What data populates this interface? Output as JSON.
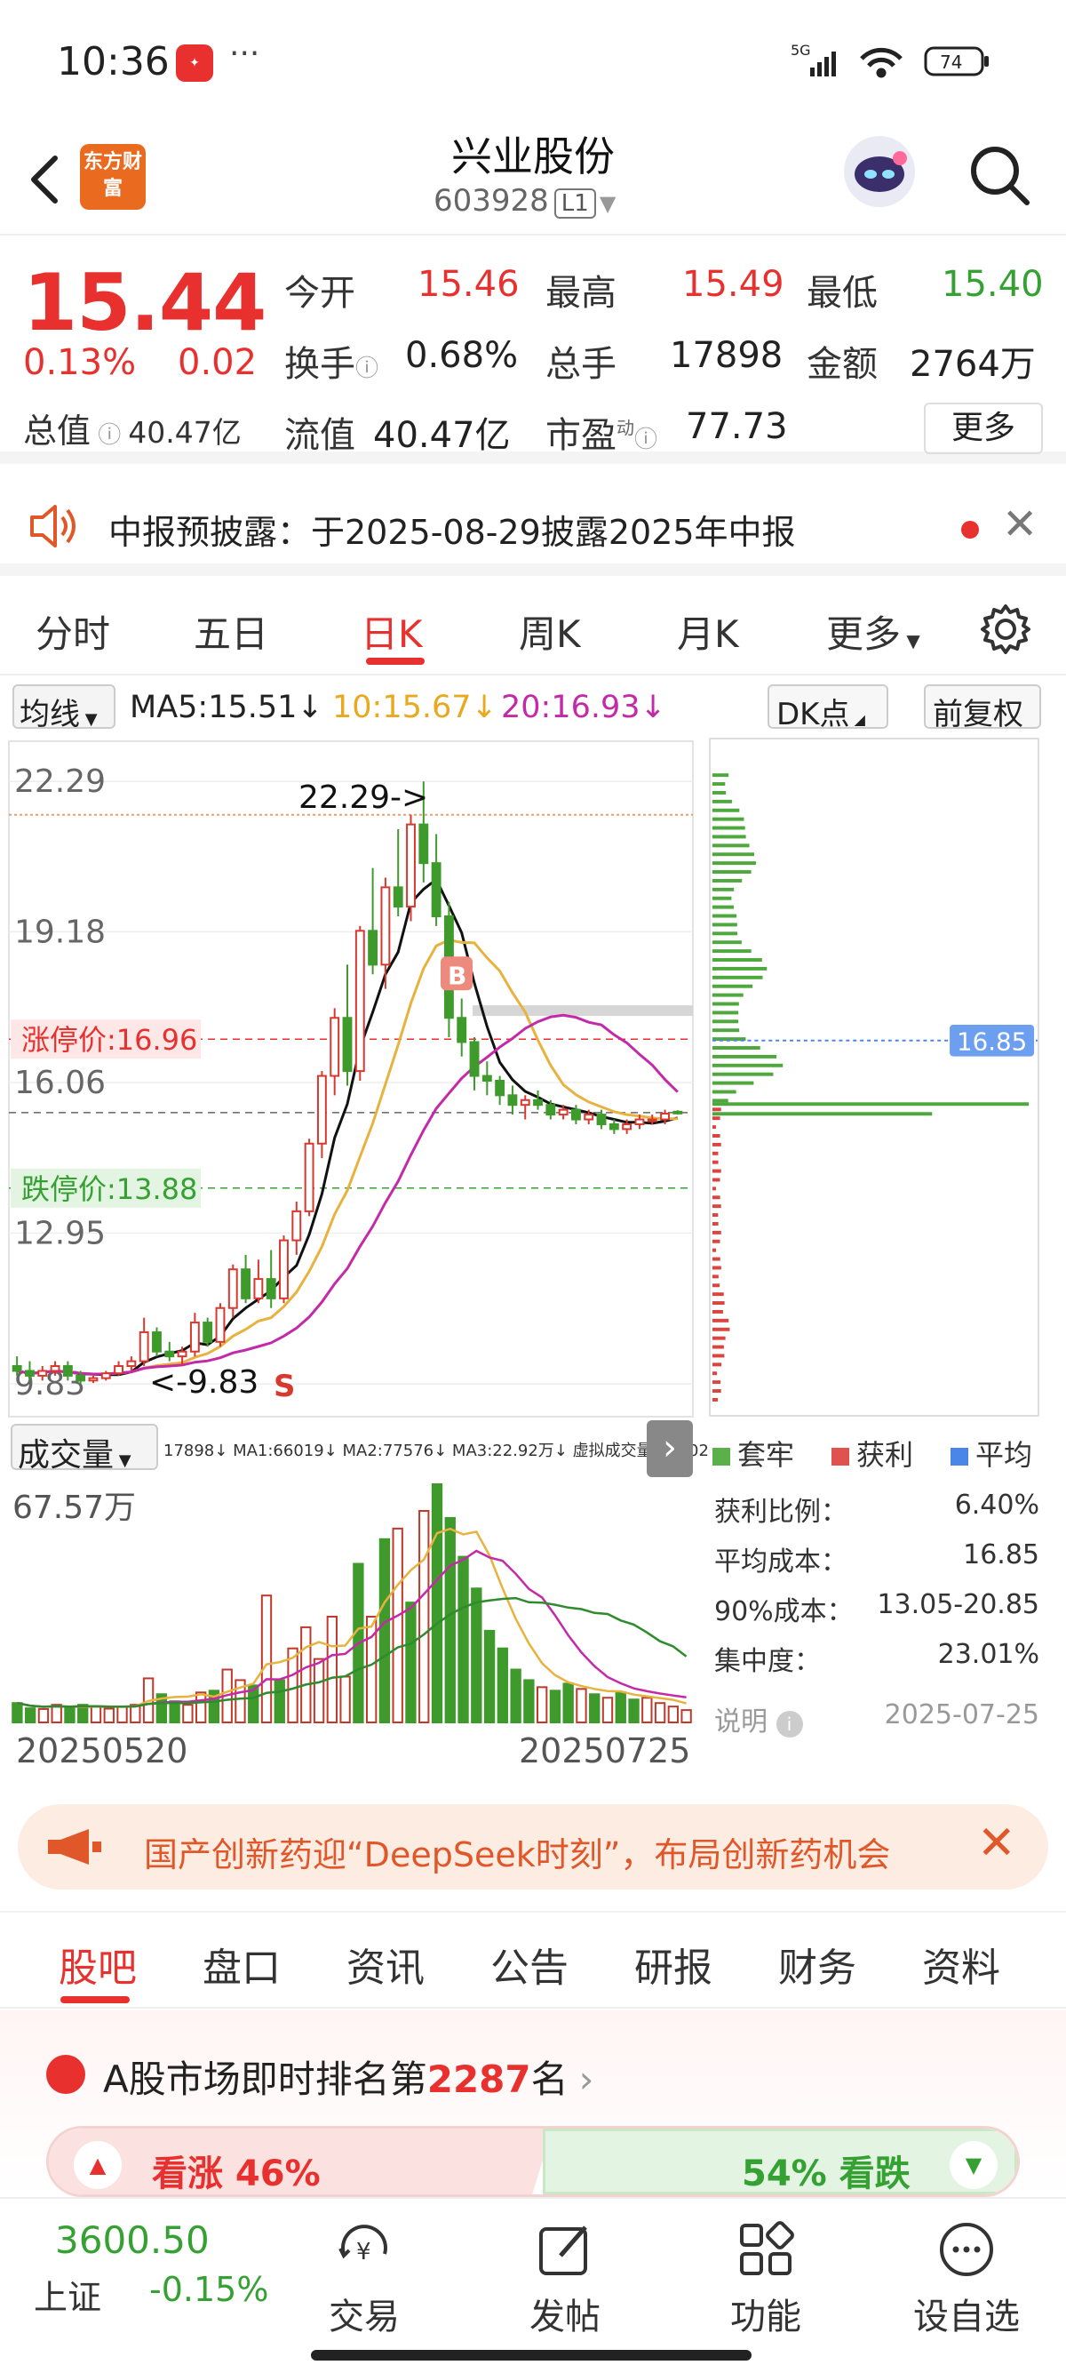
{
  "status_bar": {
    "time": "10:36",
    "dots": "···",
    "battery": "74",
    "network": "5G"
  },
  "nav": {
    "title": "兴业股份",
    "code": "603928",
    "level": "L1",
    "logo": "东方财富"
  },
  "quote": {
    "price": "15.44",
    "change_pct": "0.13%",
    "change_abs": "0.02",
    "total_value_label": "总值",
    "total_value": "40.47亿",
    "fields": [
      {
        "label": "今开",
        "value": "15.46",
        "color": "red"
      },
      {
        "label": "最高",
        "value": "15.49",
        "color": "red"
      },
      {
        "label": "最低",
        "value": "15.40",
        "color": "green"
      },
      {
        "label": "换手",
        "value": "0.68%",
        "color": "black"
      },
      {
        "label": "总手",
        "value": "17898",
        "color": "black"
      },
      {
        "label": "金额",
        "value": "2764万",
        "color": "black"
      },
      {
        "label": "流值",
        "value": "40.47亿",
        "color": "black"
      },
      {
        "label": "市盈",
        "value": "77.73",
        "color": "black"
      }
    ],
    "pe_sup": "动",
    "more_label": "更多"
  },
  "notice": {
    "text": "中报预披露：于2025-08-29披露2025年中报"
  },
  "tabs": [
    "分时",
    "五日",
    "日K",
    "周K",
    "月K",
    "更多"
  ],
  "ma": {
    "selector": "均线",
    "ma5": "MA5:15.51",
    "ma10": "10:15.67",
    "ma20": "20:16.93",
    "arrow": "↓",
    "dk": "DK点",
    "adjust": "前复权"
  },
  "chart_data": {
    "type": "candlestick",
    "y_labels": [
      "22.29",
      "19.18",
      "16.06",
      "12.95",
      "9.83"
    ],
    "y_range": [
      9.83,
      22.29
    ],
    "limit_up": "涨停价:16.96",
    "limit_down": "跌停价:13.88",
    "high_marker": "22.29->",
    "low_marker": "<-9.83",
    "chip_marker": "16.85",
    "signals": [
      "B",
      "S"
    ],
    "candles": [
      [
        10.2,
        10.4,
        10.0,
        10.1
      ],
      [
        10.1,
        10.3,
        9.9,
        10.0
      ],
      [
        10.0,
        10.2,
        9.9,
        10.1
      ],
      [
        10.1,
        10.3,
        10.0,
        10.2
      ],
      [
        10.2,
        10.3,
        9.9,
        10.0
      ],
      [
        10.0,
        10.1,
        9.83,
        9.9
      ],
      [
        9.9,
        10.0,
        9.85,
        9.95
      ],
      [
        9.95,
        10.1,
        9.9,
        10.05
      ],
      [
        10.05,
        10.3,
        10.0,
        10.2
      ],
      [
        10.2,
        10.4,
        10.1,
        10.3
      ],
      [
        10.3,
        11.2,
        10.2,
        10.9
      ],
      [
        10.9,
        11.0,
        10.4,
        10.5
      ],
      [
        10.5,
        10.7,
        10.3,
        10.4
      ],
      [
        10.4,
        10.6,
        10.2,
        10.5
      ],
      [
        10.5,
        11.3,
        10.4,
        11.1
      ],
      [
        11.1,
        11.2,
        10.6,
        10.7
      ],
      [
        10.7,
        11.5,
        10.6,
        11.4
      ],
      [
        11.4,
        12.3,
        11.2,
        12.2
      ],
      [
        12.2,
        12.5,
        11.5,
        11.6
      ],
      [
        11.6,
        12.4,
        11.5,
        12.0
      ],
      [
        12.0,
        12.6,
        11.4,
        11.6
      ],
      [
        11.6,
        12.9,
        11.5,
        12.8
      ],
      [
        12.8,
        13.6,
        12.5,
        13.4
      ],
      [
        13.4,
        14.9,
        13.3,
        14.8
      ],
      [
        14.8,
        16.3,
        14.5,
        16.2
      ],
      [
        16.2,
        17.6,
        15.8,
        17.4
      ],
      [
        17.4,
        18.5,
        16.0,
        16.3
      ],
      [
        16.3,
        19.3,
        16.1,
        19.2
      ],
      [
        19.2,
        20.5,
        18.3,
        18.5
      ],
      [
        18.5,
        20.3,
        18.0,
        20.1
      ],
      [
        20.1,
        21.3,
        19.5,
        19.7
      ],
      [
        19.7,
        21.6,
        19.4,
        21.4
      ],
      [
        21.4,
        22.29,
        20.2,
        20.6
      ],
      [
        20.6,
        21.2,
        19.3,
        19.5
      ],
      [
        19.5,
        19.8,
        17.0,
        17.4
      ],
      [
        17.4,
        17.8,
        16.6,
        16.9
      ],
      [
        16.9,
        17.0,
        15.9,
        16.2
      ],
      [
        16.2,
        16.5,
        15.8,
        16.1
      ],
      [
        16.1,
        16.2,
        15.6,
        15.8
      ],
      [
        15.8,
        16.0,
        15.4,
        15.6
      ],
      [
        15.6,
        15.8,
        15.3,
        15.7
      ],
      [
        15.7,
        15.9,
        15.5,
        15.6
      ],
      [
        15.6,
        15.7,
        15.3,
        15.4
      ],
      [
        15.4,
        15.6,
        15.3,
        15.5
      ],
      [
        15.5,
        15.6,
        15.2,
        15.3
      ],
      [
        15.3,
        15.5,
        15.2,
        15.4
      ],
      [
        15.4,
        15.5,
        15.1,
        15.2
      ],
      [
        15.2,
        15.3,
        15.0,
        15.1
      ],
      [
        15.1,
        15.3,
        15.0,
        15.2
      ],
      [
        15.2,
        15.4,
        15.1,
        15.3
      ],
      [
        15.3,
        15.4,
        15.2,
        15.3
      ],
      [
        15.3,
        15.5,
        15.2,
        15.42
      ],
      [
        15.46,
        15.49,
        15.4,
        15.44
      ]
    ]
  },
  "volume": {
    "selector": "成交量",
    "info": "17898↓ MA1:66019↓ MA2:77576↓ MA3:22.92万↓ 虚拟成交量:46602",
    "max_label": "67.57万",
    "start_date": "20250520",
    "end_date": "20250725",
    "values": [
      5.5,
      4.0,
      3.8,
      5.0,
      4.2,
      5.0,
      4.5,
      3.9,
      4.5,
      5.0,
      12.5,
      8.0,
      6.0,
      5.0,
      8.5,
      9.0,
      15.0,
      12.0,
      10.5,
      36.0,
      12.0,
      21.0,
      27.0,
      18.0,
      30.0,
      13.0,
      45.0,
      30.0,
      52.0,
      55.0,
      34.0,
      60.0,
      67.57,
      58.0,
      47.0,
      38.0,
      26.0,
      21.0,
      15.0,
      12.0,
      10.0,
      9.0,
      11.0,
      9.5,
      8.0,
      7.0,
      8.5,
      6.5,
      7.0,
      5.5,
      4.5,
      3.5
    ]
  },
  "chip": {
    "legend": [
      "套牢",
      "获利",
      "平均"
    ],
    "stats": [
      {
        "k": "获利比例：",
        "v": "6.40%"
      },
      {
        "k": "平均成本：",
        "v": "16.85"
      },
      {
        "k": "90%成本：",
        "v": "13.05-20.85"
      },
      {
        "k": "集中度：",
        "v": "23.01%"
      }
    ],
    "note_label": "说明",
    "note_date": "2025-07-25"
  },
  "ad": {
    "text": "国产创新药迎“DeepSeek时刻”，布局创新药机会"
  },
  "bottom_tabs": [
    "股吧",
    "盘口",
    "资讯",
    "公告",
    "研报",
    "财务",
    "资料"
  ],
  "rank": {
    "prefix": "A股市场即时排名第",
    "num": "2287",
    "suffix": "名",
    "up": "看涨 46%",
    "down": "54% 看跌"
  },
  "bottom_bar": {
    "index_value": "3600.50",
    "index_name": "上证",
    "index_change": "-0.15%",
    "items": [
      "交易",
      "发帖",
      "功能",
      "设自选"
    ]
  }
}
